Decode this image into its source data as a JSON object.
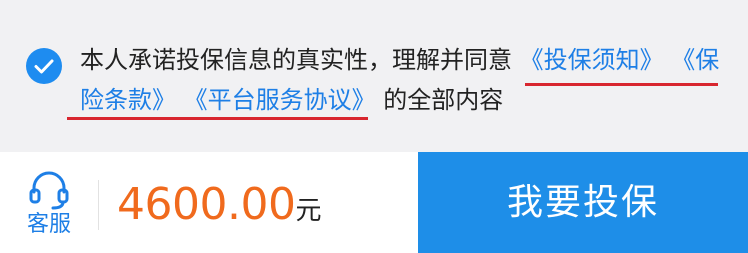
{
  "agreement": {
    "checked": true,
    "prefix_text": "本人承诺投保信息的真实性，理解并同意",
    "links": [
      "《投保须知》",
      "《保险条款》",
      "《平台服务协议》"
    ],
    "suffix_text": "的全部内容"
  },
  "footer": {
    "service_label": "客服",
    "service_icon": "headset-icon",
    "price_amount": "4600.00",
    "price_unit": "元",
    "buy_label": "我要投保"
  },
  "colors": {
    "accent_blue": "#1e8ee8",
    "price_orange": "#f06a1d",
    "underline_red": "#d8262f",
    "background": "#f1f1f3"
  }
}
